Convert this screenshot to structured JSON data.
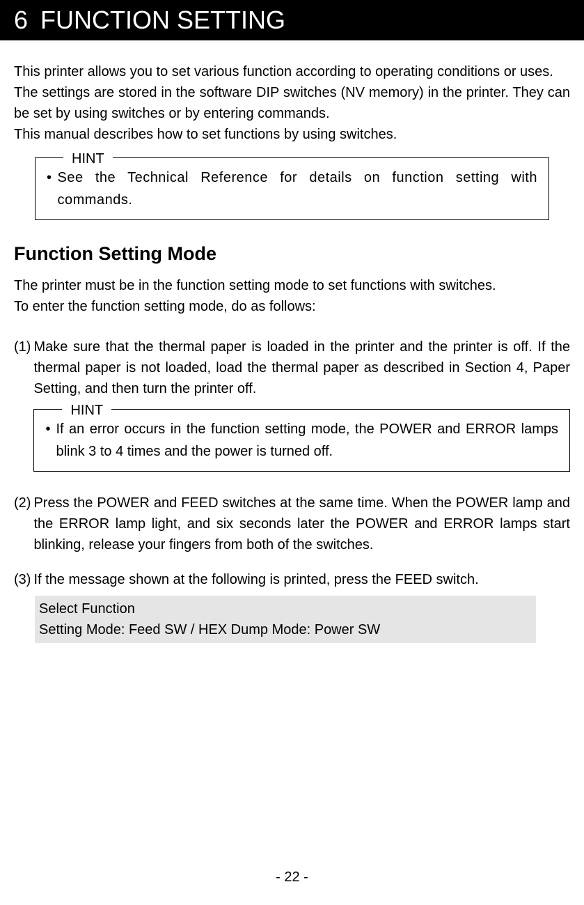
{
  "chapter": {
    "number": "6",
    "title": "FUNCTION SETTING"
  },
  "intro_paragraphs": [
    "This printer allows you to set various function according to operating conditions or uses.",
    "The settings are stored in the software DIP switches (NV memory) in the printer.  They can be set by using switches or by entering commands.",
    "This manual describes how to set functions by using switches."
  ],
  "hint1": {
    "label": "HINT",
    "text": "See the Technical Reference for details on function setting with commands."
  },
  "section": {
    "heading": "Function Setting Mode",
    "intro1": "The printer must be in the function setting mode to set functions with switches.",
    "intro2": "To enter the function setting mode, do as follows:"
  },
  "steps": {
    "s1": {
      "num": "(1)",
      "text": "Make sure that the thermal paper is loaded in the printer and the printer is off.  If the thermal paper is not loaded, load the thermal paper as described in Section 4, Paper Setting, and then turn the printer off."
    },
    "s2": {
      "num": "(2)",
      "text": "Press the POWER and FEED switches at the same time.  When the POWER lamp and the ERROR lamp light, and six seconds later the POWER and ERROR lamps start blinking, release your fingers from both of the switches."
    },
    "s3": {
      "num": "(3)",
      "text": "If the message shown at the following is printed, press the FEED switch."
    }
  },
  "hint2": {
    "label": "HINT",
    "text": "If an error occurs in the function setting mode, the POWER and ERROR lamps blink 3 to 4 times and the power is turned off."
  },
  "printed_message": {
    "line1": "Select Function",
    "line2": "Setting Mode: Feed SW / HEX Dump Mode: Power SW"
  },
  "footer": {
    "page": "- 22 -"
  }
}
